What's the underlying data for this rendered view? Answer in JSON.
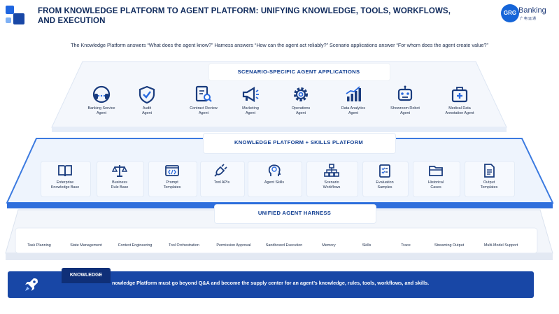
{
  "header": {
    "title": "FROM KNOWLEDGE PLATFORM TO AGENT PLATFORM: UNIFYING KNOWLEDGE, TOOLS, WORKFLOWS, AND EXECUTION",
    "brand_name": "Banking",
    "brand_mark": "GRG",
    "brand_sub": "广电运通"
  },
  "subtitle": "The Knowledge Platform answers “What does the agent know?” Harness answers “How can the agent act reliably?” Scenario applications answer “For whom does the agent create value?”",
  "layers": {
    "scenario": {
      "label": "SCENARIO-SPECIFIC AGENT APPLICATIONS",
      "items": [
        {
          "l1": "Banking Service",
          "l2": "Agent",
          "icon": "headset-icon"
        },
        {
          "l1": "Audit",
          "l2": "Agent",
          "icon": "shield-check-icon"
        },
        {
          "l1": "Contract Review",
          "l2": "Agent",
          "icon": "document-search-icon"
        },
        {
          "l1": "Marketing",
          "l2": "Agent",
          "icon": "megaphone-icon"
        },
        {
          "l1": "Operations",
          "l2": "Agent",
          "icon": "gear-icon"
        },
        {
          "l1": "Data Analytics",
          "l2": "Agent",
          "icon": "bar-chart-icon"
        },
        {
          "l1": "Showroom Robot",
          "l2": "Agent",
          "icon": "robot-icon"
        },
        {
          "l1": "Medical Data",
          "l2": "Annotation Agent",
          "icon": "medical-kit-icon"
        }
      ]
    },
    "knowledge": {
      "label": "KNOWLEDGE PLATFORM + SKILLS PLATFORM",
      "items": [
        {
          "l1": "Enterprise",
          "l2": "Knowledge Base",
          "icon": "book-icon"
        },
        {
          "l1": "Business",
          "l2": "Rule Base",
          "icon": "scales-icon"
        },
        {
          "l1": "Prompt",
          "l2": "Templates",
          "icon": "code-window-icon"
        },
        {
          "l1": "Tool APIs",
          "l2": "",
          "icon": "plug-icon"
        },
        {
          "l1": "Agent Skills",
          "l2": "",
          "icon": "brain-head-icon"
        },
        {
          "l1": "Scenario",
          "l2": "Workflows",
          "icon": "workflow-icon"
        },
        {
          "l1": "Evaluation",
          "l2": "Samples",
          "icon": "checklist-icon"
        },
        {
          "l1": "Historical",
          "l2": "Cases",
          "icon": "folder-icon"
        },
        {
          "l1": "Output",
          "l2": "Templates",
          "icon": "output-document-icon"
        }
      ]
    },
    "harness": {
      "label": "UNIFIED AGENT HARNESS",
      "items": [
        "Task Planning",
        "State Management",
        "Context Engineering",
        "Tool Orchestration",
        "Permission Approval",
        "Sandboxed Execution",
        "Memory",
        "Skills",
        "Trace",
        "Streaming Output",
        "Multi-Model Support"
      ]
    }
  },
  "footer": {
    "tab_label": "KNOWLEDGE",
    "message": "nowledge Platform must go beyond Q&A and become the supply center for an agent’s knowledge, rules, tools, workflows, and skills.",
    "icon": "rocket-icon"
  },
  "colors": {
    "primary": "#1847a6",
    "dark_blue": "#0f2f78",
    "accent": "#1e63d6",
    "light_panel": "#f3f7fd"
  }
}
